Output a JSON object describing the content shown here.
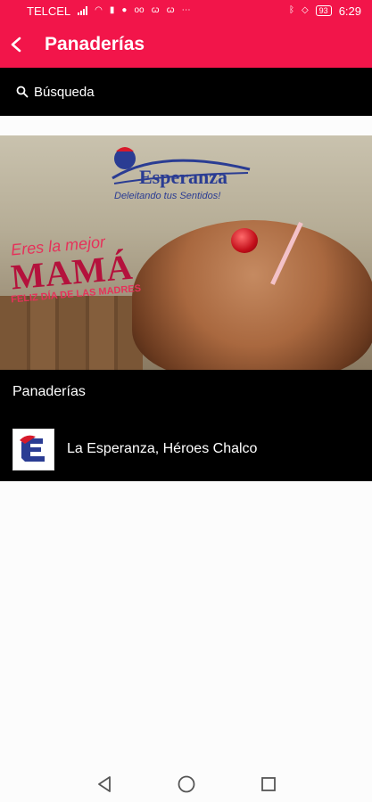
{
  "status_bar": {
    "carrier": "TELCEL",
    "battery": "93",
    "time": "6:29",
    "icons": [
      "signal-icon",
      "wifi-icon",
      "sim-icon",
      "facebook-icon",
      "voicemail-icon",
      "app-icon",
      "app-icon",
      "more-icon",
      "bluetooth-icon",
      "mute-icon"
    ]
  },
  "app_bar": {
    "title": "Panaderías",
    "back_icon": "back-arrow-icon"
  },
  "search": {
    "placeholder": "Búsqueda",
    "icon": "search-icon"
  },
  "banner": {
    "logo_text": "Esperanza",
    "tagline": "Deleitando tus Sentidos!",
    "promo_line1": "Eres la mejor",
    "promo_line2": "MAMÁ",
    "promo_line3": "FELIZ DÍA DE LAS MADRES"
  },
  "section": {
    "title": "Panaderías",
    "items": [
      {
        "label": "La Esperanza, Héroes Chalco"
      }
    ]
  },
  "nav": {
    "back": "nav-back-icon",
    "home": "nav-home-icon",
    "recents": "nav-recents-icon"
  },
  "colors": {
    "primary": "#f2154a",
    "card": "#000000",
    "brand_blue": "#2a3c93"
  }
}
